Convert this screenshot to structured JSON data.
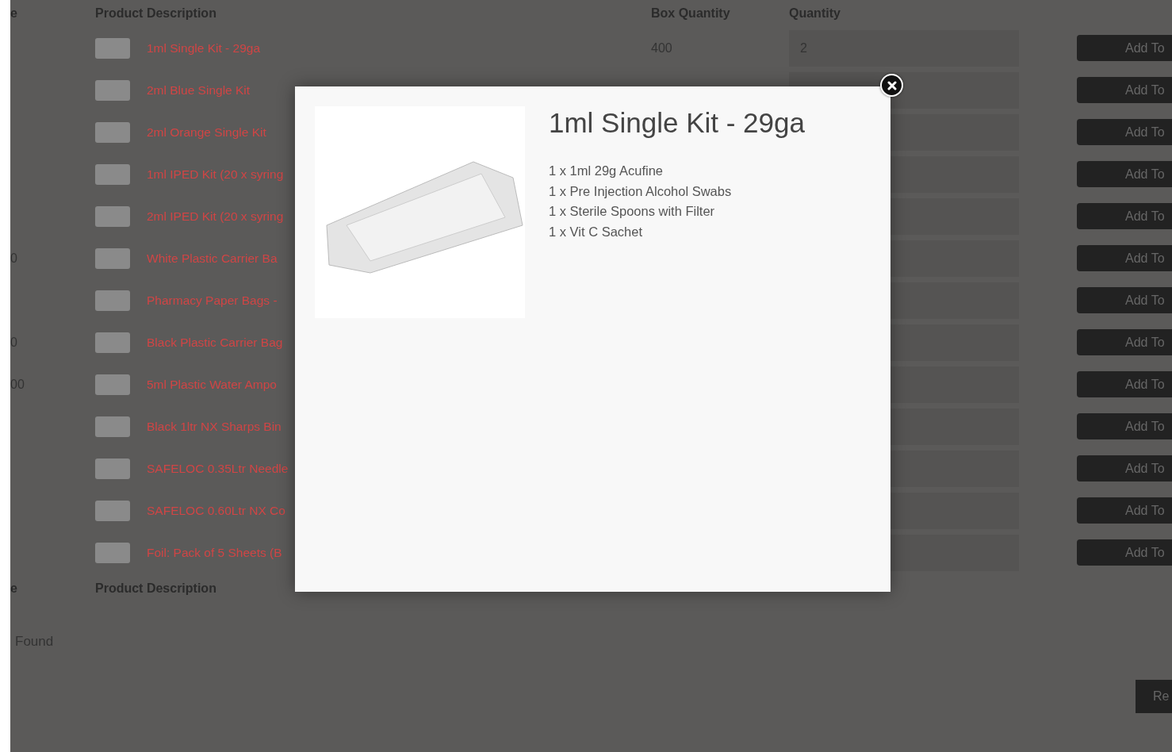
{
  "table": {
    "columns": [
      "e",
      "Product Description",
      "Box Quantity",
      "Quantity"
    ],
    "rows": [
      {
        "description": "1ml Single Kit - 29ga",
        "box_quantity": "400",
        "quantity": "2",
        "button": "Add To"
      },
      {
        "description": "2ml Blue Single Kit",
        "button": "Add To"
      },
      {
        "description": "2ml Orange Single Kit",
        "button": "Add To"
      },
      {
        "description": "1ml IPED Kit (20 x syring",
        "button": "Add To"
      },
      {
        "description": "2ml IPED Kit (20 x syring",
        "button": "Add To"
      },
      {
        "column_1": "0",
        "description": "White Plastic Carrier Ba",
        "button": "Add To"
      },
      {
        "description": "Pharmacy Paper Bags -",
        "button": "Add To"
      },
      {
        "column_1": "0",
        "description": "Black Plastic Carrier Bag",
        "button": "Add To"
      },
      {
        "column_1": "00",
        "description": "5ml Plastic Water Ampo",
        "button": "Add To"
      },
      {
        "description": "Black 1ltr NX Sharps Bin",
        "button": "Add To"
      },
      {
        "description": "SAFELOC 0.35Ltr Needle",
        "button": "Add To"
      },
      {
        "description": "SAFELOC 0.60Ltr NX Co",
        "button": "Add To"
      },
      {
        "description": "Foil: Pack of 5 Sheets (B",
        "button": "Add To"
      }
    ]
  },
  "footer_columns": [
    "e",
    "Product Description"
  ],
  "results_text": "Found",
  "bottom_button": "Re",
  "modal": {
    "title": "1ml Single Kit - 29ga",
    "lines": [
      "1 x 1ml 29g Acufine",
      "1 x Pre Injection Alcohol Swabs",
      "1 x Sterile Spoons with Filter",
      "1 x Vit C Sachet"
    ]
  }
}
